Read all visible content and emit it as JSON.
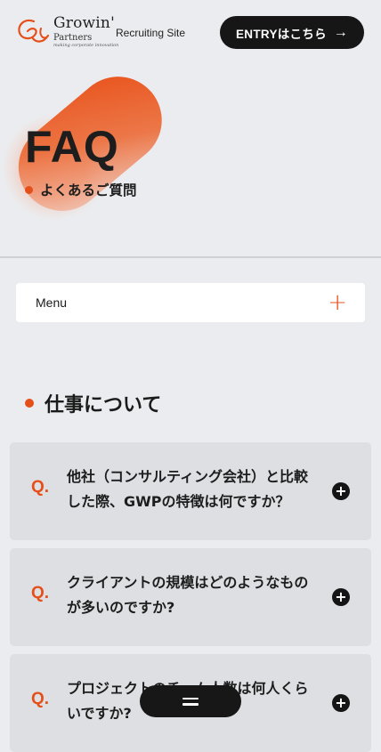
{
  "header": {
    "logo_name": "Growin'",
    "logo_sub": "Partners",
    "logo_tagline": "making corporate innovation",
    "site_label": "Recruiting Site",
    "entry_label": "ENTRYはこちら",
    "entry_arrow": "→"
  },
  "hero": {
    "title": "FAQ",
    "subtitle": "よくあるご質問"
  },
  "menu": {
    "label": "Menu",
    "toggle_icon": "plus-icon"
  },
  "section": {
    "title": "仕事について"
  },
  "faq": {
    "q_label": "Q.",
    "items": [
      {
        "question": "他社（コンサルティング会社）と比較した際、GWPの特徴は何ですか？"
      },
      {
        "question": "クライアントの規模はどのようなものが多いのですか?"
      },
      {
        "question": "プロジェクトのチーム人数は何人くらいですか?"
      }
    ]
  },
  "floating_menu": {
    "icon": "hamburger-icon"
  },
  "colors": {
    "accent": "#e5501a",
    "background": "#ebecef",
    "card": "#dedfe3",
    "dark": "#161616"
  }
}
